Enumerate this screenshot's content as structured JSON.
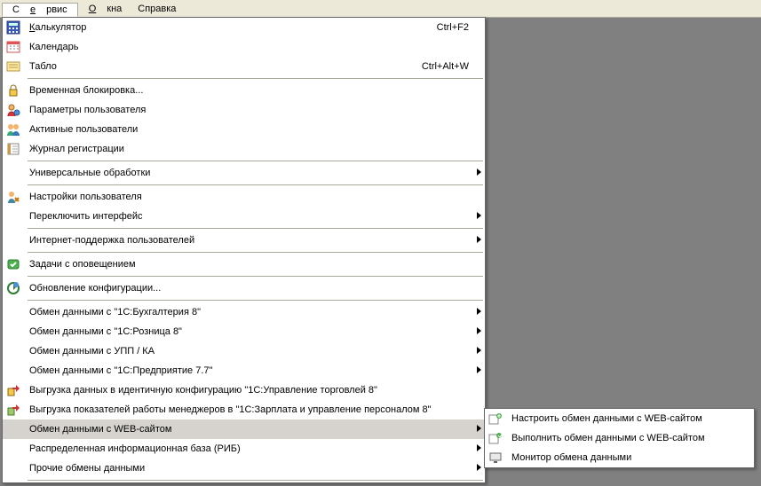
{
  "menubar": {
    "service_pre": "С",
    "service_u": "е",
    "service_post": "рвис",
    "windows_u": "О",
    "windows_post": "кна",
    "help": "Справка"
  },
  "menu": {
    "calc_u": "К",
    "calc_post": "алькулятор",
    "calc_sc": "Ctrl+F2",
    "calendar": "Календарь",
    "tablo": "Табло",
    "tablo_sc": "Ctrl+Alt+W",
    "temp_lock": "Временная блокировка...",
    "user_params": "Параметры пользователя",
    "active_users": "Активные пользователи",
    "reg_journal": "Журнал регистрации",
    "universal_proc": "Универсальные обработки",
    "user_settings": "Настройки пользователя",
    "switch_iface": "Переключить интерфейс",
    "inet_support": "Интернет-поддержка пользователей",
    "tasks_notif": "Задачи с оповещением",
    "config_update": "Обновление конфигурации...",
    "ex_buh": "Обмен данными с \"1С:Бухгалтерия 8\"",
    "ex_roz": "Обмен данными с \"1С:Розница 8\"",
    "ex_upp": "Обмен данными с УПП / КА",
    "ex_pred": "Обмен данными с \"1С:Предприятие 7.7\"",
    "export_ut": "Выгрузка данных в идентичную конфигурацию \"1С:Управление торговлей 8\"",
    "export_mgr": "Выгрузка показателей работы менеджеров в \"1С:Зарплата и управление персоналом 8\"",
    "ex_web": "Обмен данными с WEB-сайтом",
    "dist_base": "Распределенная информационная база (РИБ)",
    "other_ex": "Прочие обмены данными"
  },
  "submenu": {
    "configure": "Настроить обмен данными с WEB-сайтом",
    "execute": "Выполнить обмен данными с WEB-сайтом",
    "monitor": "Монитор обмена данными"
  }
}
